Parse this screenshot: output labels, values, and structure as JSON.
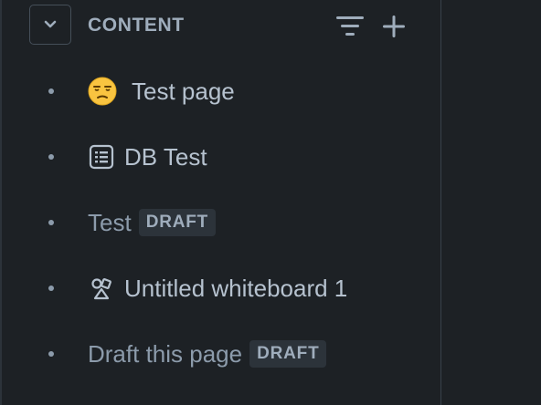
{
  "sidebar": {
    "section": {
      "title": "CONTENT",
      "collapse_icon": "chevron-down-icon",
      "filter_icon": "filter-icon",
      "add_icon": "plus-icon"
    },
    "items": [
      {
        "label": "Test page",
        "icon": "unamused-face-emoji",
        "badge": null
      },
      {
        "label": "DB Test",
        "icon": "database-icon",
        "badge": null
      },
      {
        "label": "Test",
        "icon": null,
        "badge": "DRAFT"
      },
      {
        "label": "Untitled whiteboard 1",
        "icon": "whiteboard-icon",
        "badge": null
      },
      {
        "label": "Draft this page",
        "icon": null,
        "badge": "DRAFT"
      }
    ]
  },
  "colors": {
    "background": "#1d2125",
    "text": "#b6c2cf",
    "muted_text": "#8c9bab",
    "badge_bg": "#2c333a"
  }
}
